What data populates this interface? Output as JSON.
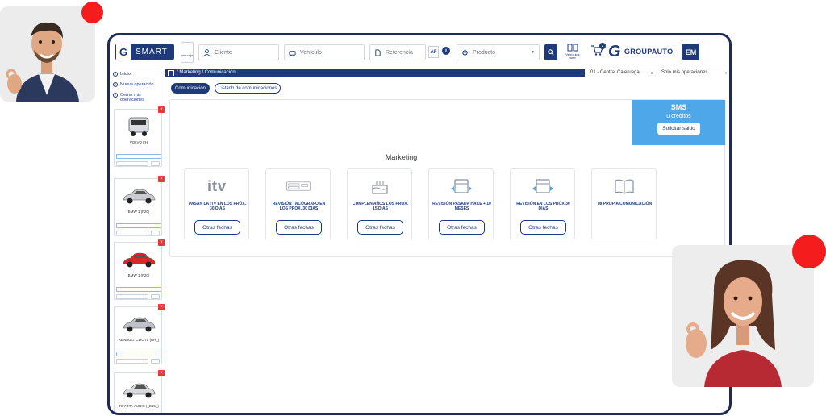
{
  "app": {
    "logo_text": "SMART",
    "ver_caja": "ver caja",
    "search": {
      "cliente_placeholder": "Cliente",
      "vehiculo_placeholder": "Vehículo",
      "referencia_placeholder": "Referencia",
      "af_label": "AF",
      "producto_placeholder": "Producto"
    },
    "vehiculos_web": "Vehículos web",
    "cart_count": "2",
    "brand": "GROUPAUTO",
    "user_initials": "EM"
  },
  "sidebar": {
    "nav": [
      {
        "label": "Inicio",
        "icon": "home-icon"
      },
      {
        "label": "Nueva operación",
        "icon": "plus-circle-icon"
      },
      {
        "label": "Cerrar mis operaciones",
        "icon": "close-circle-icon"
      }
    ],
    "vehicles": [
      {
        "name": "VOLVO FH",
        "color": "#d9dde3",
        "kind": "truck"
      },
      {
        "name": "BMW 1 (F20)",
        "color": "#c9ccd2",
        "kind": "car"
      },
      {
        "name": "BMW 1 (F20)",
        "color": "#d9262b",
        "kind": "car"
      },
      {
        "name": "RENAULT CLIO IV (BH_)",
        "color": "#bfc3c9",
        "kind": "car"
      },
      {
        "name": "TOYOTA AURIS (_E15_)",
        "color": "#d7d9dc",
        "kind": "car"
      }
    ]
  },
  "breadcrumb": "/ Marketing / Comunicación",
  "selectors": {
    "center": "01 - Central Caleruega",
    "filter": "Solo mis operaciones"
  },
  "tabs": [
    {
      "label": "Comunicación",
      "active": true
    },
    {
      "label": "Listado de comunicaciones",
      "active": false
    }
  ],
  "sms": {
    "title": "SMS",
    "credits": "0 créditos",
    "button": "Solicitar saldo"
  },
  "marketing": {
    "title": "Marketing",
    "itv_mark": "itv",
    "cards": [
      {
        "label": "PASAN LA ITV EN LOS PRÓX. 30 DÍAS",
        "icon": "itv-icon",
        "button": "Otras fechas"
      },
      {
        "label": "REVISIÓN TACÓGRAFO EN LOS PRÓX. 30 DÍAS",
        "icon": "tachograph-icon",
        "button": "Otras fechas"
      },
      {
        "label": "CUMPLEN AÑOS LOS PRÓX. 15 DÍAS",
        "icon": "cake-icon",
        "button": "Otras fechas"
      },
      {
        "label": "REVISIÓN PASADA HACE + 10 MESES",
        "icon": "calendar-back-icon",
        "button": "Otras fechas"
      },
      {
        "label": "REVISIÓN EN LOS PRÓX 30 DÍAS",
        "icon": "calendar-forward-icon",
        "button": "Otras fechas"
      },
      {
        "label": "MI PROPIA COMUNICACIÓN",
        "icon": "book-icon",
        "button": null
      }
    ]
  },
  "colors": {
    "navy": "#1e3a7b",
    "sms_blue": "#4da7e8",
    "accent_red": "#f41c1c"
  }
}
